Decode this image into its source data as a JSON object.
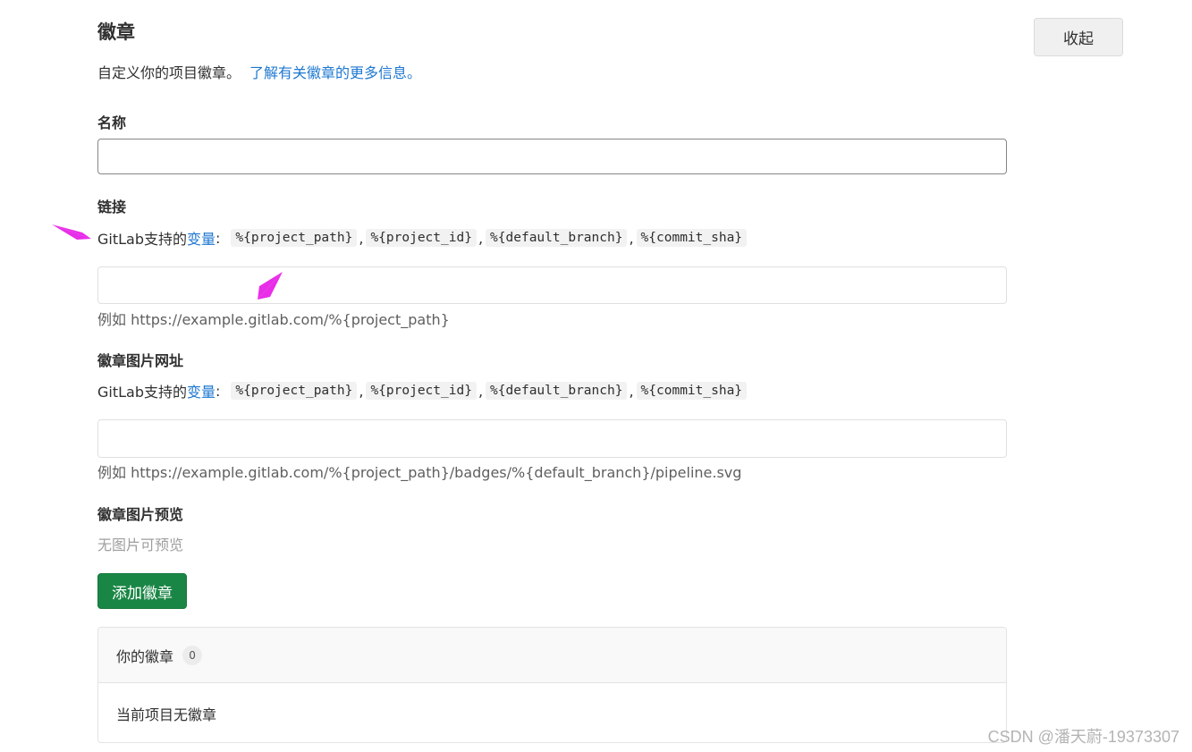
{
  "header": {
    "title": "徽章",
    "collapse_label": "收起",
    "description": "自定义你的项目徽章。",
    "learn_more_link": "了解有关徽章的更多信息。"
  },
  "form": {
    "name": {
      "label": "名称",
      "value": ""
    },
    "link": {
      "label": "链接",
      "help_prefix": "GitLab支持的",
      "help_link": "变量",
      "help_colon": ":",
      "variables": [
        "%{project_path}",
        "%{project_id}",
        "%{default_branch}",
        "%{commit_sha}"
      ],
      "value": "",
      "example": "例如 https://example.gitlab.com/%{project_path}"
    },
    "image_url": {
      "label": "徽章图片网址",
      "help_prefix": "GitLab支持的",
      "help_link": "变量",
      "help_colon": ":",
      "variables": [
        "%{project_path}",
        "%{project_id}",
        "%{default_branch}",
        "%{commit_sha}"
      ],
      "value": "",
      "example": "例如 https://example.gitlab.com/%{project_path}/badges/%{default_branch}/pipeline.svg"
    },
    "preview": {
      "label": "徽章图片预览",
      "empty_text": "无图片可预览"
    },
    "submit_label": "添加徽章"
  },
  "badges_list": {
    "title": "你的徽章",
    "count": "0",
    "empty_text": "当前项目无徽章"
  },
  "watermark": "CSDN @潘天蔚-19373307",
  "colors": {
    "link": "#1f78d1",
    "primary_button": "#1a8645",
    "annotation_arrow": "#e82ee8"
  }
}
